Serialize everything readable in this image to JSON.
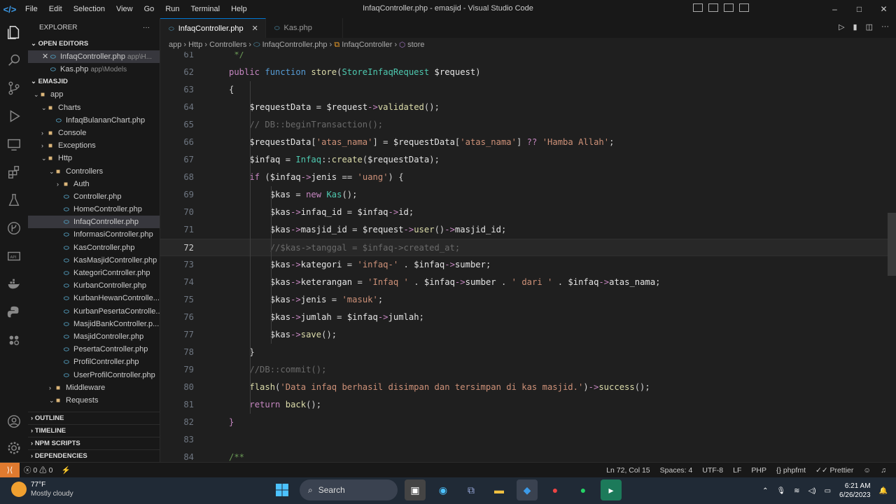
{
  "titlebar": {
    "menu": [
      "File",
      "Edit",
      "Selection",
      "View",
      "Go",
      "Run",
      "Terminal",
      "Help"
    ],
    "title": "InfaqController.php - emasjid - Visual Studio Code",
    "controls": [
      "–",
      "□",
      "✕"
    ]
  },
  "sidebar": {
    "header": "EXPLORER",
    "open_editors": {
      "label": "OPEN EDITORS",
      "items": [
        {
          "name": "InfaqController.php",
          "path": "app\\H..."
        },
        {
          "name": "Kas.php",
          "path": "app\\Models"
        }
      ]
    },
    "project": {
      "label": "EMASJID",
      "tree": [
        {
          "label": "app",
          "type": "folder",
          "depth": 0,
          "open": true
        },
        {
          "label": "Charts",
          "type": "folder",
          "depth": 1,
          "open": true
        },
        {
          "label": "InfaqBulananChart.php",
          "type": "file",
          "depth": 2
        },
        {
          "label": "Console",
          "type": "folder",
          "depth": 1,
          "open": false
        },
        {
          "label": "Exceptions",
          "type": "folder",
          "depth": 1,
          "open": false
        },
        {
          "label": "Http",
          "type": "folder",
          "depth": 1,
          "open": true
        },
        {
          "label": "Controllers",
          "type": "folder",
          "depth": 2,
          "open": true
        },
        {
          "label": "Auth",
          "type": "folder",
          "depth": 3,
          "open": false
        },
        {
          "label": "Controller.php",
          "type": "file",
          "depth": 3
        },
        {
          "label": "HomeController.php",
          "type": "file",
          "depth": 3
        },
        {
          "label": "InfaqController.php",
          "type": "file",
          "depth": 3,
          "selected": true
        },
        {
          "label": "InformasiController.php",
          "type": "file",
          "depth": 3
        },
        {
          "label": "KasController.php",
          "type": "file",
          "depth": 3
        },
        {
          "label": "KasMasjidController.php",
          "type": "file",
          "depth": 3
        },
        {
          "label": "KategoriController.php",
          "type": "file",
          "depth": 3
        },
        {
          "label": "KurbanController.php",
          "type": "file",
          "depth": 3
        },
        {
          "label": "KurbanHewanControlle...",
          "type": "file",
          "depth": 3
        },
        {
          "label": "KurbanPesertaControlle...",
          "type": "file",
          "depth": 3
        },
        {
          "label": "MasjidBankController.p...",
          "type": "file",
          "depth": 3
        },
        {
          "label": "MasjidController.php",
          "type": "file",
          "depth": 3
        },
        {
          "label": "PesertaController.php",
          "type": "file",
          "depth": 3
        },
        {
          "label": "ProfilController.php",
          "type": "file",
          "depth": 3
        },
        {
          "label": "UserProfilController.php",
          "type": "file",
          "depth": 3
        },
        {
          "label": "Middleware",
          "type": "folder",
          "depth": 2,
          "open": false
        },
        {
          "label": "Requests",
          "type": "folder",
          "depth": 2,
          "open": true
        }
      ]
    },
    "bottom_sections": [
      "OUTLINE",
      "TIMELINE",
      "NPM SCRIPTS",
      "DEPENDENCIES"
    ]
  },
  "tabs": [
    {
      "label": "InfaqController.php",
      "active": true
    },
    {
      "label": "Kas.php",
      "active": false
    }
  ],
  "breadcrumb": [
    "app",
    "Http",
    "Controllers",
    "InfaqController.php",
    "InfaqController",
    "store"
  ],
  "editor": {
    "current_line": 72,
    "lines": [
      {
        "n": 61,
        "html": "<span class='c'> */</span>"
      },
      {
        "n": 62,
        "html": "<span class='k'>public</span> <span class='kb'>function</span> <span class='f'>store</span><span class='op'>(</span><span class='cl'>StoreInfaqRequest</span> <span class='vw'>$request</span><span class='op'>)</span>"
      },
      {
        "n": 63,
        "html": "<span class='op'>{</span>"
      },
      {
        "n": 64,
        "html": "    <span class='vw'>$requestData</span> <span class='op'>=</span> <span class='vw'>$request</span><span class='ar'>-&gt;</span><span class='f'>validated</span><span class='op'>();</span>"
      },
      {
        "n": 65,
        "html": "    <span class='cm'>// DB::beginTransaction();</span>"
      },
      {
        "n": 66,
        "html": "    <span class='vw'>$requestData</span><span class='op'>[</span><span class='s'>'atas_nama'</span><span class='op'>]</span> <span class='op'>=</span> <span class='vw'>$requestData</span><span class='op'>[</span><span class='s'>'atas_nama'</span><span class='op'>]</span> <span class='k'>??</span> <span class='s'>'Hamba Allah'</span><span class='op'>;</span>"
      },
      {
        "n": 67,
        "html": "    <span class='vw'>$infaq</span> <span class='op'>=</span> <span class='cl'>Infaq</span><span class='op'>::</span><span class='f'>create</span><span class='op'>(</span><span class='vw'>$requestData</span><span class='op'>);</span>"
      },
      {
        "n": 68,
        "html": "    <span class='k'>if</span> <span class='op'>(</span><span class='vw'>$infaq</span><span class='ar'>-&gt;</span><span class='vw'>jenis</span> <span class='op'>==</span> <span class='s'>'uang'</span><span class='op'>)</span> <span class='op'>{</span>"
      },
      {
        "n": 69,
        "html": "        <span class='vw'>$kas</span> <span class='op'>=</span> <span class='k'>new</span> <span class='cl'>Kas</span><span class='op'>();</span>"
      },
      {
        "n": 70,
        "html": "        <span class='vw'>$kas</span><span class='ar'>-&gt;</span><span class='vw'>infaq_id</span> <span class='op'>=</span> <span class='vw'>$infaq</span><span class='ar'>-&gt;</span><span class='vw'>id</span><span class='op'>;</span>"
      },
      {
        "n": 71,
        "html": "        <span class='vw'>$kas</span><span class='ar'>-&gt;</span><span class='vw'>masjid_id</span> <span class='op'>=</span> <span class='vw'>$request</span><span class='ar'>-&gt;</span><span class='f'>user</span><span class='op'>()</span><span class='ar'>-&gt;</span><span class='vw'>masjid_id</span><span class='op'>;</span>"
      },
      {
        "n": 72,
        "html": "        <span class='cm'>//$kas-&gt;tanggal = $infaq-&gt;created_at;</span>"
      },
      {
        "n": 73,
        "html": "        <span class='vw'>$kas</span><span class='ar'>-&gt;</span><span class='vw'>kategori</span> <span class='op'>=</span> <span class='s'>'infaq-'</span> <span class='op'>.</span> <span class='vw'>$infaq</span><span class='ar'>-&gt;</span><span class='vw'>sumber</span><span class='op'>;</span>"
      },
      {
        "n": 74,
        "html": "        <span class='vw'>$kas</span><span class='ar'>-&gt;</span><span class='vw'>keterangan</span> <span class='op'>=</span> <span class='s'>'Infaq '</span> <span class='op'>.</span> <span class='vw'>$infaq</span><span class='ar'>-&gt;</span><span class='vw'>sumber</span> <span class='op'>.</span> <span class='s'>' dari '</span> <span class='op'>.</span> <span class='vw'>$infaq</span><span class='ar'>-&gt;</span><span class='vw'>atas_nama</span><span class='op'>;</span>"
      },
      {
        "n": 75,
        "html": "        <span class='vw'>$kas</span><span class='ar'>-&gt;</span><span class='vw'>jenis</span> <span class='op'>=</span> <span class='s'>'masuk'</span><span class='op'>;</span>"
      },
      {
        "n": 76,
        "html": "        <span class='vw'>$kas</span><span class='ar'>-&gt;</span><span class='vw'>jumlah</span> <span class='op'>=</span> <span class='vw'>$infaq</span><span class='ar'>-&gt;</span><span class='vw'>jumlah</span><span class='op'>;</span>"
      },
      {
        "n": 77,
        "html": "        <span class='vw'>$kas</span><span class='ar'>-&gt;</span><span class='f'>save</span><span class='op'>();</span>"
      },
      {
        "n": 78,
        "html": "    <span class='op'>}</span>"
      },
      {
        "n": 79,
        "html": "    <span class='cm'>//DB::commit();</span>"
      },
      {
        "n": 80,
        "html": "    <span class='f'>flash</span><span class='op'>(</span><span class='s'>'Data infaq berhasil disimpan dan tersimpan di kas masjid.'</span><span class='op'>)</span><span class='ar'>-&gt;</span><span class='f'>success</span><span class='op'>();</span>"
      },
      {
        "n": 81,
        "html": "    <span class='k'>return</span> <span class='f'>back</span><span class='op'>();</span>"
      },
      {
        "n": 82,
        "html": "<span class='k'>}</span>"
      },
      {
        "n": 83,
        "html": ""
      },
      {
        "n": 84,
        "html": "<span class='c'>/**</span>"
      }
    ]
  },
  "statusbar": {
    "problems": "ⓧ 0 ⚠ 0",
    "position": "Ln 72, Col 15",
    "spaces": "Spaces: 4",
    "encoding": "UTF-8",
    "eol": "LF",
    "language": "PHP",
    "formatter": "phpfmt",
    "prettier": "Prettier"
  },
  "taskbar": {
    "temp": "77°F",
    "weather": "Mostly cloudy",
    "search": "Search",
    "time": "6:21 AM",
    "date": "6/26/2023"
  }
}
